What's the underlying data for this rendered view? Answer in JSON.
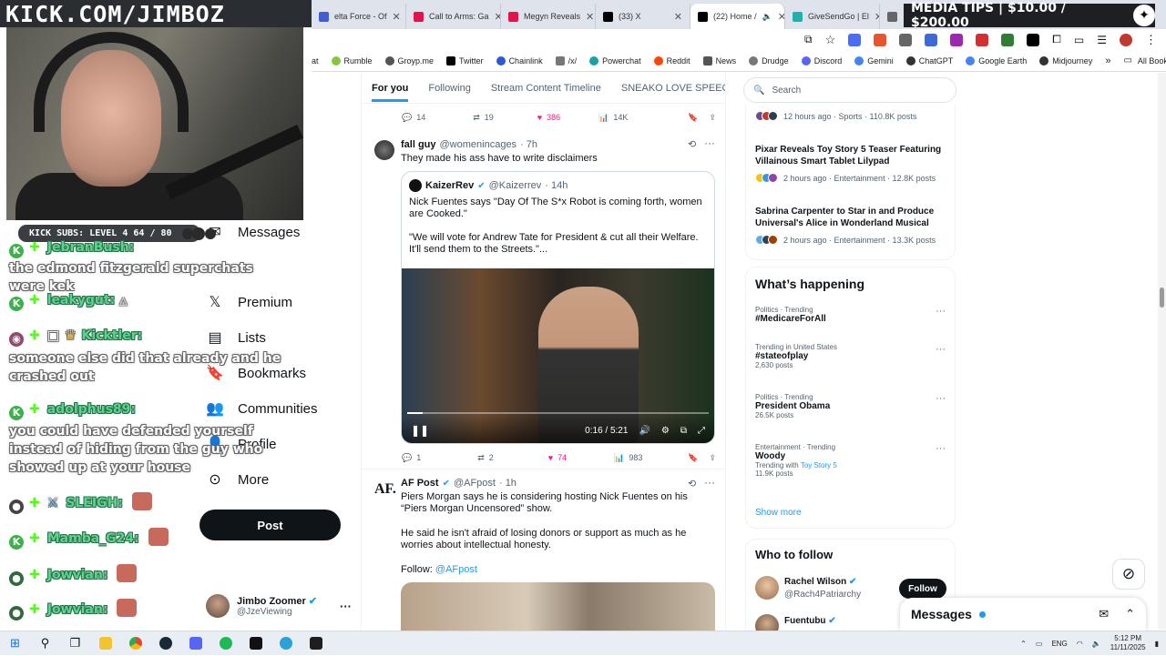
{
  "overlay": {
    "banner": "KICK.COM/JIMBOZ",
    "subs_label": "KICK SUBS: LEVEL 4",
    "subs_count": "64 / 80"
  },
  "media_tips": {
    "text": "MEDIA TIPS | $10.00 / $200.00"
  },
  "tabs": [
    {
      "label": "elta Force - Of",
      "color": "#3c5fd3"
    },
    {
      "label": "Call to Arms: Ga",
      "color": "#e3124b"
    },
    {
      "label": "Megyn Reveals",
      "color": "#e3124b"
    },
    {
      "label": "(33) X",
      "color": "#000000"
    },
    {
      "label": "(22) Home /",
      "color": "#000000"
    },
    {
      "label": "GiveSendGo | El",
      "color": "#20b2aa"
    },
    {
      "label": "",
      "color": "#666666"
    }
  ],
  "bookmarks": [
    {
      "label": "at",
      "color": ""
    },
    {
      "label": "Rumble",
      "color": "#85c742"
    },
    {
      "label": "Groyp.me",
      "color": "#555555"
    },
    {
      "label": "Twitter",
      "color": "#000000"
    },
    {
      "label": "Chainlink",
      "color": "#2a5ada"
    },
    {
      "label": "/x/",
      "color": "#777777"
    },
    {
      "label": "Powerchat",
      "color": "#1aa1a1"
    },
    {
      "label": "Reddit",
      "color": "#ff4500"
    },
    {
      "label": "News",
      "color": "#555555"
    },
    {
      "label": "Drudge",
      "color": "#777777"
    },
    {
      "label": "Discord",
      "color": "#5865f2"
    },
    {
      "label": "Gemini",
      "color": "#4285f4"
    },
    {
      "label": "ChatGPT",
      "color": "#333333"
    },
    {
      "label": "Google Earth",
      "color": "#4285f4"
    },
    {
      "label": "Midjourney",
      "color": "#333333"
    }
  ],
  "all_bookmarks": "All Bookmarks",
  "nav": {
    "messages": "Messages",
    "premium": "Premium",
    "lists": "Lists",
    "bookmarks": "Bookmarks",
    "communities": "Communities",
    "profile": "Profile",
    "more": "More",
    "post": "Post"
  },
  "account": {
    "name": "Jimbo Zoomer",
    "handle": "@JzeViewing"
  },
  "chat": [
    {
      "user": "JebranBush:",
      "text": "the edmond fitzgerald superchats were kek"
    },
    {
      "user": "leakygut:",
      "text": ""
    },
    {
      "user": "Kicktler:",
      "text": "someone else did that already and he crashed out"
    },
    {
      "user": "adolphus89:",
      "text": "you could have defended yourself instead of hiding from the guy who showed up at your house"
    },
    {
      "user": "SLEIGH:",
      "text": ""
    },
    {
      "user": "Mamba_G24:",
      "text": ""
    },
    {
      "user": "Jowvian:",
      "text": ""
    },
    {
      "user": "Jowvian:",
      "text": ""
    }
  ],
  "feed": {
    "tabs": [
      "For you",
      "Following",
      "Stream Content Timeline",
      "SNEAKO LOVE SPEECH"
    ],
    "top_actions": {
      "replies": "14",
      "reposts": "19",
      "likes": "386",
      "views": "14K"
    },
    "tweet1": {
      "name": "fall guy",
      "handle": "@womenincages",
      "time": "· 7h",
      "text": "They made his ass have to write disclaimers",
      "quote": {
        "name": "KaizerRev",
        "handle": "@Kaizerrev",
        "time": "· 14h",
        "text": "Nick Fuentes says \"Day Of The S*x Robot is coming forth, women are Cooked.\"\n\n\"We will vote for Andrew Tate for President & cut all their Welfare. It'll send them to the Streets.\"..."
      },
      "video_time": "0:16 / 5:21",
      "video_progress": 0.05,
      "actions": {
        "replies": "1",
        "reposts": "2",
        "likes": "74",
        "views": "983"
      }
    },
    "tweet2": {
      "name": "AF Post",
      "handle": "@AFpost",
      "time": "· 1h",
      "avatar": "AF.",
      "text1": "Piers Morgan says he is considering hosting Nick Fuentes on his “Piers Morgan Uncensored” show.",
      "text2": "He said he isn't afraid of losing donors or support as much as he worries about intellectual honesty.",
      "follow_label": "Follow:",
      "follow_link": "@AFpost"
    }
  },
  "right": {
    "search_placeholder": "Search",
    "news": [
      {
        "title": "",
        "meta": "12 hours ago · Sports · 110.8K posts"
      },
      {
        "title": "Pixar Reveals Toy Story 5 Teaser Featuring Villainous Smart Tablet Lilypad",
        "meta": "2 hours ago · Entertainment · 12.8K posts"
      },
      {
        "title": "Sabrina Carpenter to Star in and Produce Universal's Alice in Wonderland Musical",
        "meta": "2 hours ago · Entertainment · 13.3K posts"
      }
    ],
    "whats_happening": "What’s happening",
    "trends": [
      {
        "meta": "Politics · Trending",
        "name": "#MedicareForAll",
        "posts": ""
      },
      {
        "meta": "Trending in United States",
        "name": "#stateofplay",
        "posts": "2,630 posts"
      },
      {
        "meta": "Politics · Trending",
        "name": "President Obama",
        "posts": "26.5K posts"
      },
      {
        "meta": "Entertainment · Trending",
        "name": "Woody",
        "posts": "11.9K posts",
        "with_label": "Trending with",
        "with_link": "Toy Story 5"
      }
    ],
    "show_more": "Show more",
    "who_to_follow": "Who to follow",
    "follow_suggestions": [
      {
        "name": "Rachel Wilson",
        "handle": "@Rach4Patriarchy",
        "button": "Follow"
      },
      {
        "name": "Fuentubu",
        "handle": ""
      }
    ],
    "messages_dock": "Messages"
  },
  "taskbar": {
    "lang": "ENG",
    "time": "5:12 PM",
    "date": "11/11/2025"
  },
  "colors": {
    "accent": "#1d9bf0",
    "like": "#f91880",
    "kick_green": "#53fc18"
  }
}
